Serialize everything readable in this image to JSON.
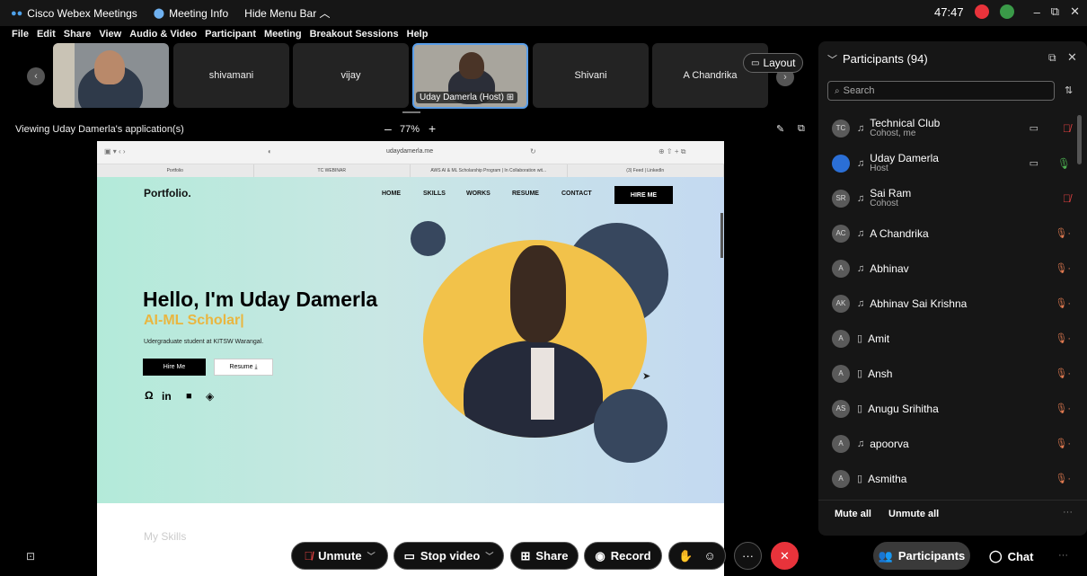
{
  "titlebar": {
    "app_name": "Cisco Webex Meetings",
    "meeting_info": "Meeting Info",
    "hide_menu": "Hide Menu Bar ︿",
    "timer": "47:47",
    "minimize": "–",
    "maximize": "⧉",
    "close": "✕"
  },
  "menu": [
    "File",
    "Edit",
    "Share",
    "View",
    "Audio & Video",
    "Participant",
    "Meeting",
    "Breakout Sessions",
    "Help"
  ],
  "filmstrip": {
    "tiles": [
      {
        "label": ""
      },
      {
        "label": "shivamani"
      },
      {
        "label": "vijay"
      },
      {
        "label": "Uday Damerla (Host)"
      },
      {
        "label": "Shivani"
      },
      {
        "label": "A Chandrika"
      }
    ],
    "layout_label": "Layout"
  },
  "share": {
    "viewing": "Viewing Uday Damerla's application(s)",
    "zoom_minus": "–",
    "zoom": "77%",
    "zoom_plus": "+"
  },
  "browser": {
    "url": "udaydamerla.me",
    "tabs": [
      "Portfolio",
      "TC WEBINAR",
      "AWS AI & ML Scholarship Program | In Collaboration wit...",
      "(3) Feed | LinkedIn"
    ]
  },
  "portfolio": {
    "logo": "Portfolio.",
    "nav": [
      "HOME",
      "SKILLS",
      "WORKS",
      "RESUME",
      "CONTACT"
    ],
    "hire_nav": "HIRE ME",
    "headline": "Hello, I'm Uday Damerla",
    "role": "AI-ML Scholar|",
    "subtitle": "Udergraduate student at KITSW Warangal.",
    "hire_btn": "Hire Me",
    "resume_btn": "Resume ⤓",
    "below_fold": "My Skills"
  },
  "panel": {
    "title": "Participants (94)",
    "search_placeholder": "Search",
    "participants": [
      {
        "initials": "TC",
        "name": "Technical Club",
        "role": "Cohost, me",
        "device": "headset",
        "cam": true,
        "mic": "off"
      },
      {
        "initials": "",
        "name": "Uday Damerla",
        "role": "Host",
        "device": "headset",
        "cam": true,
        "mic": "on"
      },
      {
        "initials": "SR",
        "name": "Sai Ram",
        "role": "Cohost",
        "device": "headset",
        "cam": false,
        "mic": "off"
      },
      {
        "initials": "AC",
        "name": "A Chandrika",
        "role": "",
        "device": "headset",
        "cam": false,
        "mic": "muted"
      },
      {
        "initials": "A",
        "name": "Abhinav",
        "role": "",
        "device": "headset",
        "cam": false,
        "mic": "muted"
      },
      {
        "initials": "AK",
        "name": "Abhinav Sai Krishna",
        "role": "",
        "device": "headset",
        "cam": false,
        "mic": "muted"
      },
      {
        "initials": "A",
        "name": "Amit",
        "role": "",
        "device": "phone",
        "cam": false,
        "mic": "muted"
      },
      {
        "initials": "A",
        "name": "Ansh",
        "role": "",
        "device": "phone",
        "cam": false,
        "mic": "muted"
      },
      {
        "initials": "AS",
        "name": "Anugu Srihitha",
        "role": "",
        "device": "phone",
        "cam": false,
        "mic": "muted"
      },
      {
        "initials": "A",
        "name": "apoorva",
        "role": "",
        "device": "headset",
        "cam": false,
        "mic": "muted"
      },
      {
        "initials": "A",
        "name": "Asmitha",
        "role": "",
        "device": "phone",
        "cam": false,
        "mic": "muted"
      }
    ],
    "mute_all": "Mute all",
    "unmute_all": "Unmute all"
  },
  "bottombar": {
    "unmute": "Unmute",
    "stop_video": "Stop video",
    "share": "Share",
    "record": "Record",
    "participants": "Participants",
    "chat": "Chat"
  },
  "colors": {
    "end_call": "#e8333b",
    "accent": "#5a9ee8",
    "portfolio_yellow": "#f2c24a",
    "portfolio_navy": "#37475e"
  }
}
